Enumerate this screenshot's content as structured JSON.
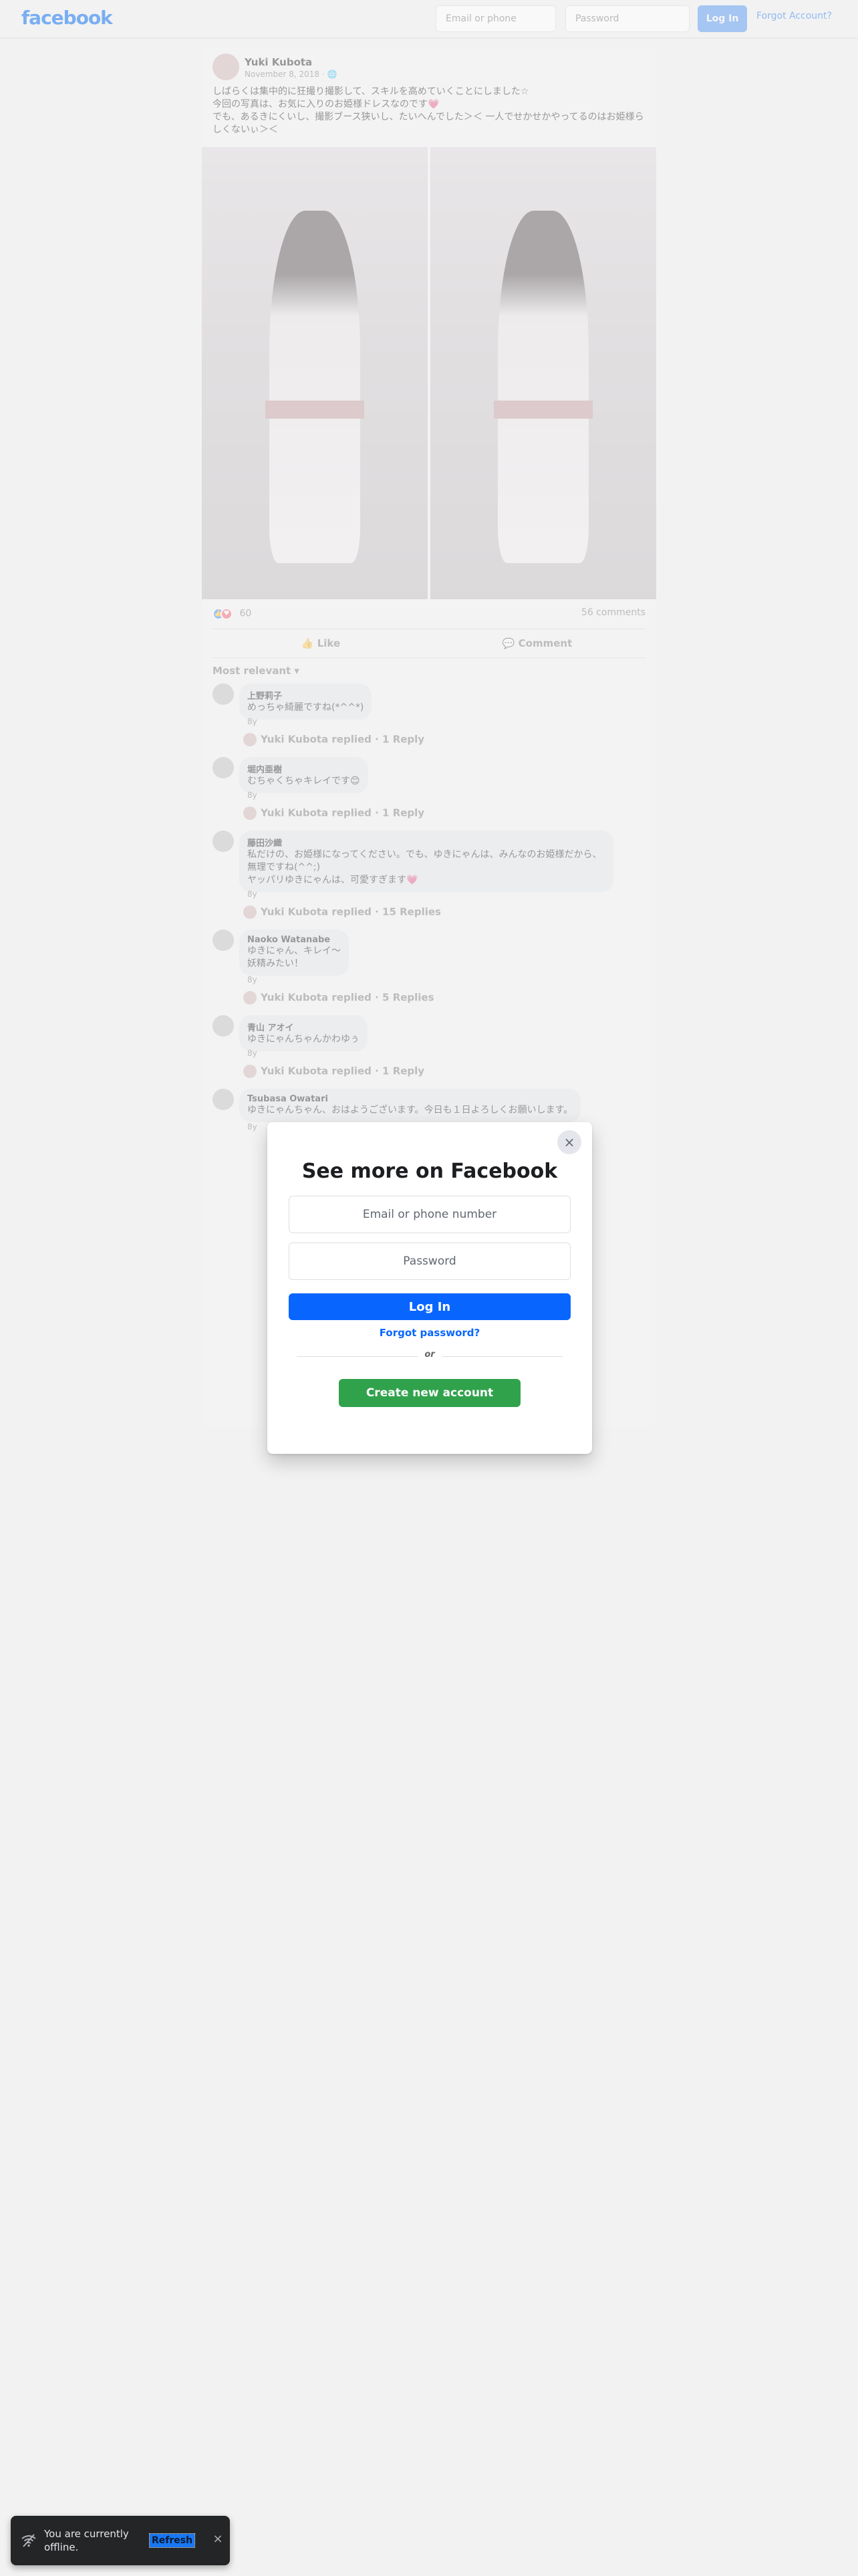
{
  "topbar": {
    "logo": "facebook",
    "email_placeholder": "Email or phone",
    "password_placeholder": "Password",
    "login_label": "Log In",
    "forgot_label": "Forgot Account?"
  },
  "post": {
    "author": "Yuki Kubota",
    "date": "November 8, 2018 · 🌐",
    "text": "しばらくは集中的に狂撮り撮影して、スキルを高めていくことにしました☆\n今回の写真は、お気に入りのお姫様ドレスなのです💗\nでも、あるきにくいし、撮影ブース狭いし、たいへんでした＞＜ 一人でせかせかやってるのはお姫様らしくないぃ＞＜",
    "reactions_count": "60",
    "comments_label": "56 comments",
    "like_label": "Like",
    "comment_label": "Comment",
    "sort_label": "Most relevant ▾"
  },
  "comments": [
    {
      "name": "上野莉子",
      "text": "めっちゃ綺麗ですね(*^^*)",
      "meta": "8y",
      "reply": "Yuki Kubota replied · 1 Reply"
    },
    {
      "name": "堀内亜樹",
      "text": "むちゃくちゃキレイです😊",
      "meta": "8y",
      "reply": "Yuki Kubota replied · 1 Reply"
    },
    {
      "name": "藤田沙織",
      "text": "私だけの、お姫様になってください。でも、ゆきにゃんは、みんなのお姫様だから、無理ですね(^^;)\nヤッパリゆきにゃんは、可愛すぎます💗",
      "meta": "8y",
      "reply": "Yuki Kubota replied · 15 Replies"
    },
    {
      "name": "Naoko Watanabe",
      "text": "ゆきにゃん、キレイ〜\n妖精みたい！",
      "meta": "8y",
      "reply": "Yuki Kubota replied · 5 Replies"
    },
    {
      "name": "青山 アオイ",
      "text": "ゆきにゃんちゃんかわゆぅ",
      "meta": "8y",
      "reply": "Yuki Kubota replied · 1 Reply"
    },
    {
      "name": "Tsubasa Owatari",
      "text": "ゆきにゃんちゃん、おはようございます。今日も１日よろしくお願いします。",
      "meta": "8y",
      "reply": ""
    }
  ],
  "modal": {
    "title": "See more on Facebook",
    "email_placeholder": "Email or phone number",
    "password_placeholder": "Password",
    "login_label": "Log In",
    "forgot_label": "Forgot password?",
    "or_label": "or",
    "create_label": "Create new account",
    "close_icon": "×"
  },
  "toast": {
    "text": "You are currently offline.",
    "refresh_label": "Refresh",
    "close_icon": "×"
  }
}
